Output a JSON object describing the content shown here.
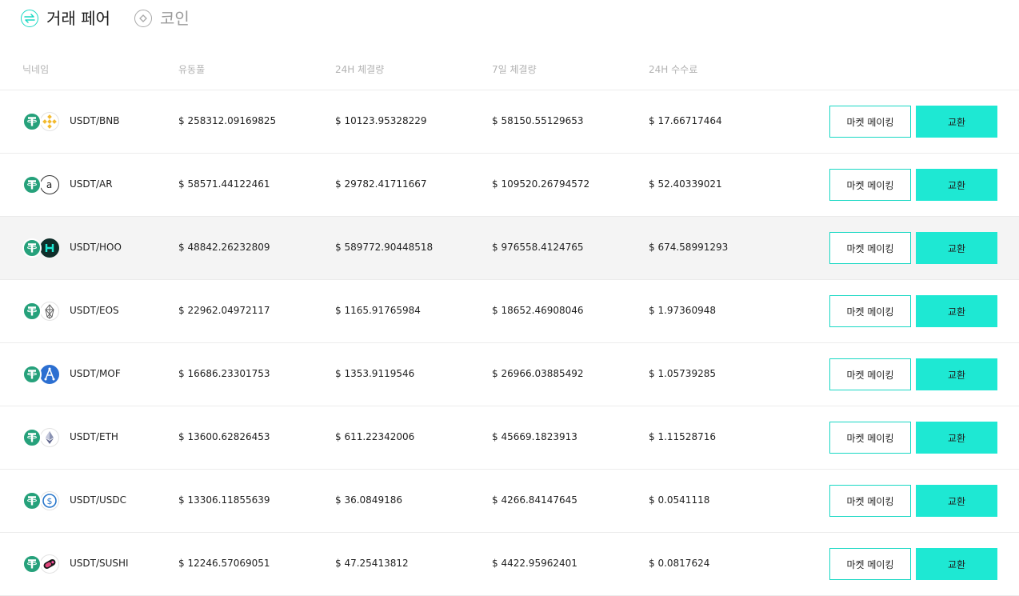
{
  "tabs": [
    {
      "label": "거래 페어",
      "icon": "swap-arrows-icon"
    },
    {
      "label": "코인",
      "icon": "coin-icon"
    }
  ],
  "columns": {
    "nickname": "닉네임",
    "liquidity": "유동풀",
    "volume_24h": "24H 체결량",
    "volume_7d": "7일 체결량",
    "fee_24h": "24H 수수료"
  },
  "colors": {
    "accent": "#1ee8d3",
    "tether": "#26a17b"
  },
  "rows": [
    {
      "pair": "USDT/BNB",
      "base_icon": "tether-icon",
      "quote_icon": "bnb-icon",
      "liquidity": "$ 258312.09169825",
      "volume_24h": "$ 10123.95328229",
      "volume_7d": "$ 58150.55129653",
      "fee_24h": "$ 17.66717464",
      "market_making": "마켓 메이킹",
      "swap": "교환"
    },
    {
      "pair": "USDT/AR",
      "base_icon": "tether-icon",
      "quote_icon": "arweave-icon",
      "liquidity": "$ 58571.44122461",
      "volume_24h": "$ 29782.41711667",
      "volume_7d": "$ 109520.26794572",
      "fee_24h": "$ 52.40339021",
      "market_making": "마켓 메이킹",
      "swap": "교환"
    },
    {
      "pair": "USDT/HOO",
      "base_icon": "tether-icon",
      "quote_icon": "hoo-icon",
      "liquidity": "$ 48842.26232809",
      "volume_24h": "$ 589772.90448518",
      "volume_7d": "$ 976558.4124765",
      "fee_24h": "$ 674.58991293",
      "market_making": "마켓 메이킹",
      "swap": "교환"
    },
    {
      "pair": "USDT/EOS",
      "base_icon": "tether-icon",
      "quote_icon": "eos-icon",
      "liquidity": "$ 22962.04972117",
      "volume_24h": "$ 1165.91765984",
      "volume_7d": "$ 18652.46908046",
      "fee_24h": "$ 1.97360948",
      "market_making": "마켓 메이킹",
      "swap": "교환"
    },
    {
      "pair": "USDT/MOF",
      "base_icon": "tether-icon",
      "quote_icon": "mof-icon",
      "liquidity": "$ 16686.23301753",
      "volume_24h": "$ 1353.9119546",
      "volume_7d": "$ 26966.03885492",
      "fee_24h": "$ 1.05739285",
      "market_making": "마켓 메이킹",
      "swap": "교환"
    },
    {
      "pair": "USDT/ETH",
      "base_icon": "tether-icon",
      "quote_icon": "ethereum-icon",
      "liquidity": "$ 13600.62826453",
      "volume_24h": "$ 611.22342006",
      "volume_7d": "$ 45669.1823913",
      "fee_24h": "$ 1.11528716",
      "market_making": "마켓 메이킹",
      "swap": "교환"
    },
    {
      "pair": "USDT/USDC",
      "base_icon": "tether-icon",
      "quote_icon": "usdc-icon",
      "liquidity": "$ 13306.11855639",
      "volume_24h": "$ 36.0849186",
      "volume_7d": "$ 4266.84147645",
      "fee_24h": "$ 0.0541118",
      "market_making": "마켓 메이킹",
      "swap": "교환"
    },
    {
      "pair": "USDT/SUSHI",
      "base_icon": "tether-icon",
      "quote_icon": "sushi-icon",
      "liquidity": "$ 12246.57069051",
      "volume_24h": "$ 47.25413812",
      "volume_7d": "$ 4422.95962401",
      "fee_24h": "$ 0.0817624",
      "market_making": "마켓 메이킹",
      "swap": "교환"
    }
  ]
}
